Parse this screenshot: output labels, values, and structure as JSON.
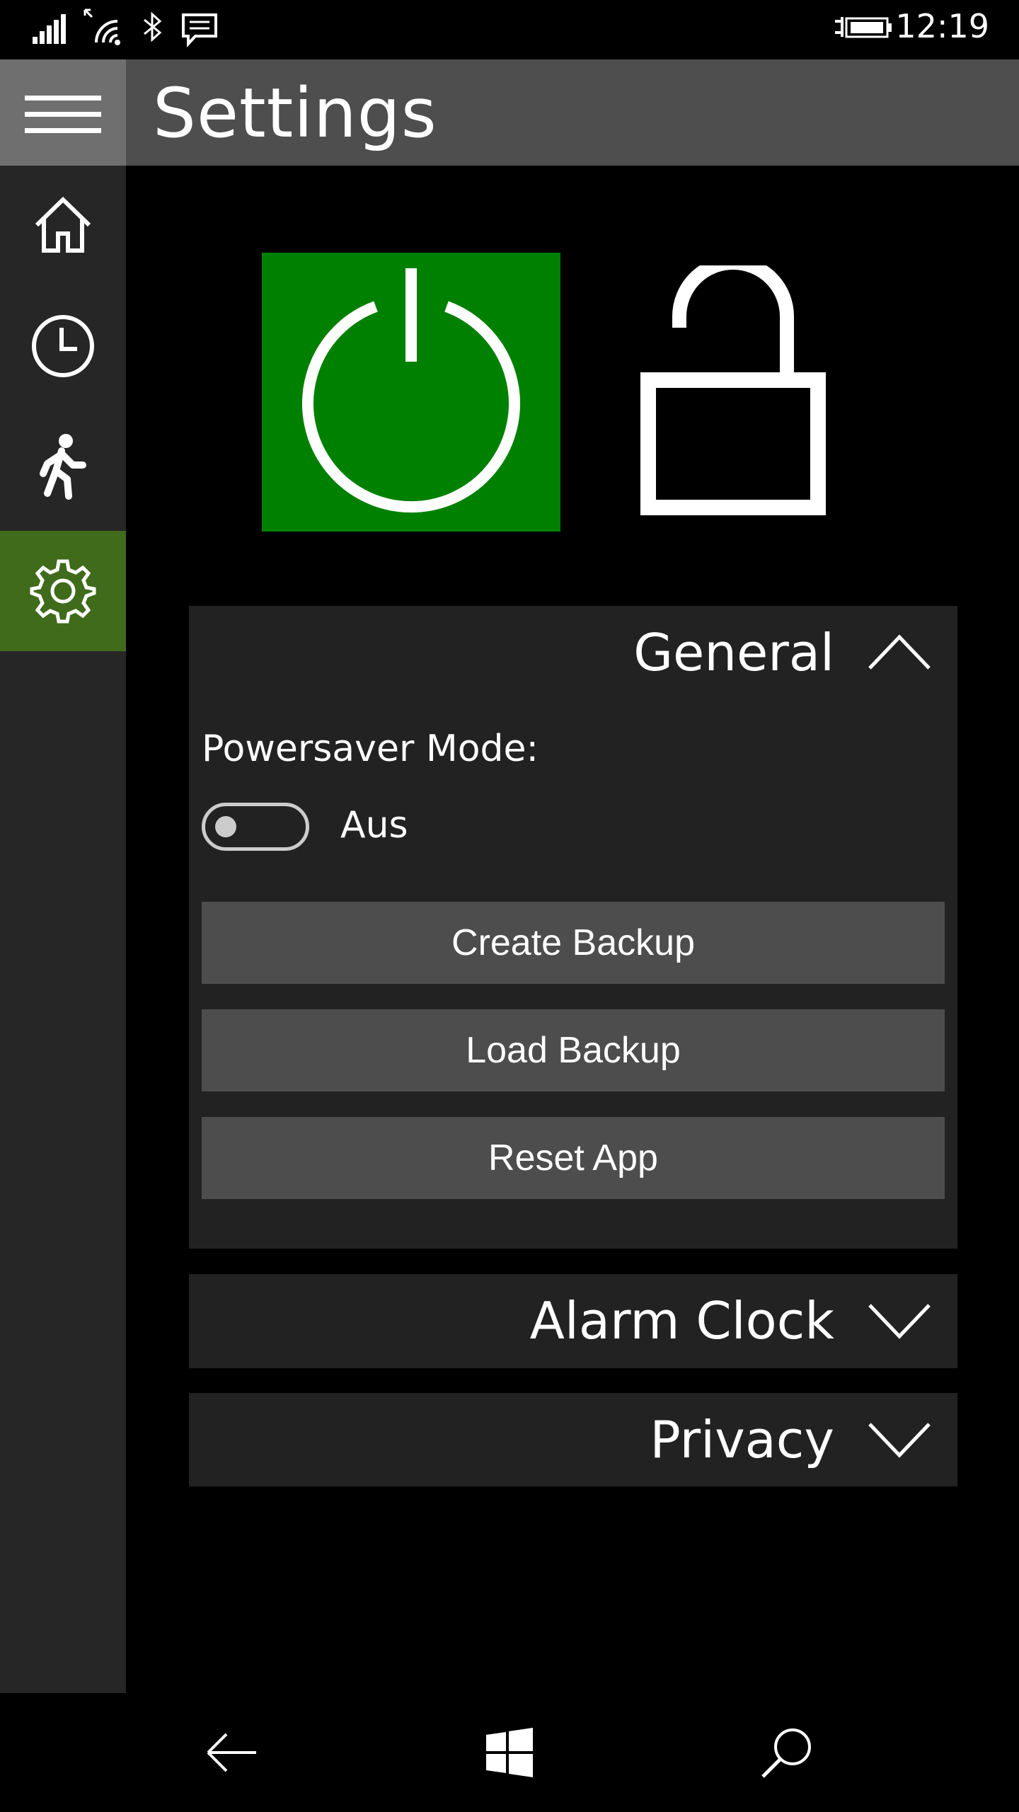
{
  "status_bar": {
    "time": "12:19",
    "icons": [
      "signal-icon",
      "wifi-icon",
      "bluetooth-icon",
      "message-icon",
      "battery-charging-icon"
    ]
  },
  "header": {
    "title": "Settings",
    "menu_icon": "hamburger-icon"
  },
  "sidebar": {
    "items": [
      {
        "icon": "home-icon",
        "active": false
      },
      {
        "icon": "clock-icon",
        "active": false
      },
      {
        "icon": "walking-person-icon",
        "active": false
      },
      {
        "icon": "gear-icon",
        "active": true
      }
    ],
    "active_color": "#3f6b1b"
  },
  "tiles": {
    "power": {
      "icon": "power-icon",
      "color": "#008000"
    },
    "lock": {
      "icon": "unlocked-padlock-icon"
    }
  },
  "sections": {
    "general": {
      "title": "General",
      "expanded": true,
      "powersaver_label": "Powersaver Mode:",
      "powersaver_state": "Aus",
      "powersaver_on": false,
      "buttons": {
        "create_backup": "Create Backup",
        "load_backup": "Load Backup",
        "reset_app": "Reset App"
      }
    },
    "alarm_clock": {
      "title": "Alarm Clock",
      "expanded": false
    },
    "privacy": {
      "title": "Privacy",
      "expanded": false
    }
  },
  "bottom_nav": [
    "back-arrow-icon",
    "windows-icon",
    "search-icon"
  ]
}
